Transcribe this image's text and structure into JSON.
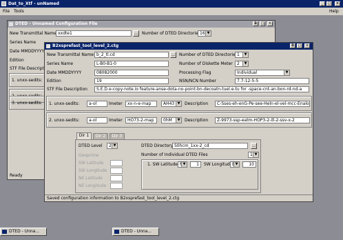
{
  "app": {
    "title": "Dat_to_Xtf - unNamed",
    "menu": [
      "File",
      "Tools"
    ],
    "help": "Help"
  },
  "win1": {
    "title": "DTED - Unnamed Configuration File",
    "new_transmittal_label": "New Transmittal Name",
    "new_transmittal_value": "xxdte1",
    "num_dirs_label": "Number of DTED Directories",
    "num_dirs_value": "16",
    "series_label": "Series Name",
    "date_label": "Date MMDDYYYY",
    "edition_label": "Edition",
    "stf_label": "STF File Descriptio",
    "rows": [
      "1. unxx-sedits:",
      "2. unxx-sedits:",
      "3. unxx-sedits:"
    ],
    "status": "Ready"
  },
  "win2": {
    "title": "B2xsprefast_tool_level_2.ctg",
    "new_transmittal_label": "New Transmittal Name",
    "new_transmittal_value": "b_2_tl.cd",
    "browse": "...",
    "num_dirs_label": "Number of DTED Directories",
    "num_dirs_value": "1",
    "series_label": "Series Name",
    "series_value": "L-B0-B1-0",
    "num_disks_label": "Number of Diskette Meter",
    "num_disks_value": "2",
    "date_label": "Date MMDDYYYY",
    "date_value": "08082000",
    "processing_label": "Processing Flag",
    "processing_value": "Individual",
    "edition_label": "Edition",
    "edition_value": "19",
    "nsn_label": "NSN/NCN Number",
    "nsn_value": "7.7-12-5-5",
    "stf_label": "STF File Description",
    "stf_value": "S.E.D.e-copy-note.io feature-anse-dota-no-point-bn-decoatn-tuel.e-tu for -space-cnt-an-bon-rd-nd-a",
    "rows": [
      {
        "label": "1. unxx-sedits:",
        "v1": "a-ol",
        "lmeter": "lmeter",
        "v2": "xx-n-e-map",
        "combo": "AH43",
        "desc_label": "Description",
        "desc": "C-Sses-eh-enG-Pe-see-Heln-el-vel-mcc-Enalo"
      },
      {
        "label": "2. unxx-sedits:",
        "v1": "a-ol",
        "lmeter": "lmeter",
        "v2": "HO73-2-map",
        "combo": "0hM",
        "desc_label": "Description",
        "desc": "Z-9973-ssp-eatm-HOP3-2-ill-2-ssv-x-2"
      }
    ],
    "tabs": [
      "Dir 1",
      "Dir 2",
      "Dir 3"
    ],
    "dted_level_label": "DTED Level",
    "dted_level_value": "2",
    "dted_dir_label": "DTED Directory",
    "dted_dir_value": "S0hcm_1xx-2_cd",
    "num_files_label": "Number of Individual DTED Files",
    "num_files_value": "1",
    "geoprime_label": "Geoprime",
    "coord_labels": [
      "SW Latitude",
      "SW Longitude",
      "NE Latitude",
      "NE Longitude"
    ],
    "file_row_label": "1. SW Latitude",
    "file_row_combo": "N",
    "file_row_val1": "1",
    "file_row_lon_label": "SW Longitude",
    "file_row_lon_combo": "E",
    "file_row_val2": "10",
    "status": "Saved configuration information to B2xsprefast_tool_level_2.ctg"
  },
  "taskbar": {
    "item1": "DTED - Unna...",
    "item2": "DTED - Unna..."
  },
  "colors": {
    "title_active": "#0a246a",
    "desktop": "#8c8c94",
    "face": "#d4d0c8"
  }
}
